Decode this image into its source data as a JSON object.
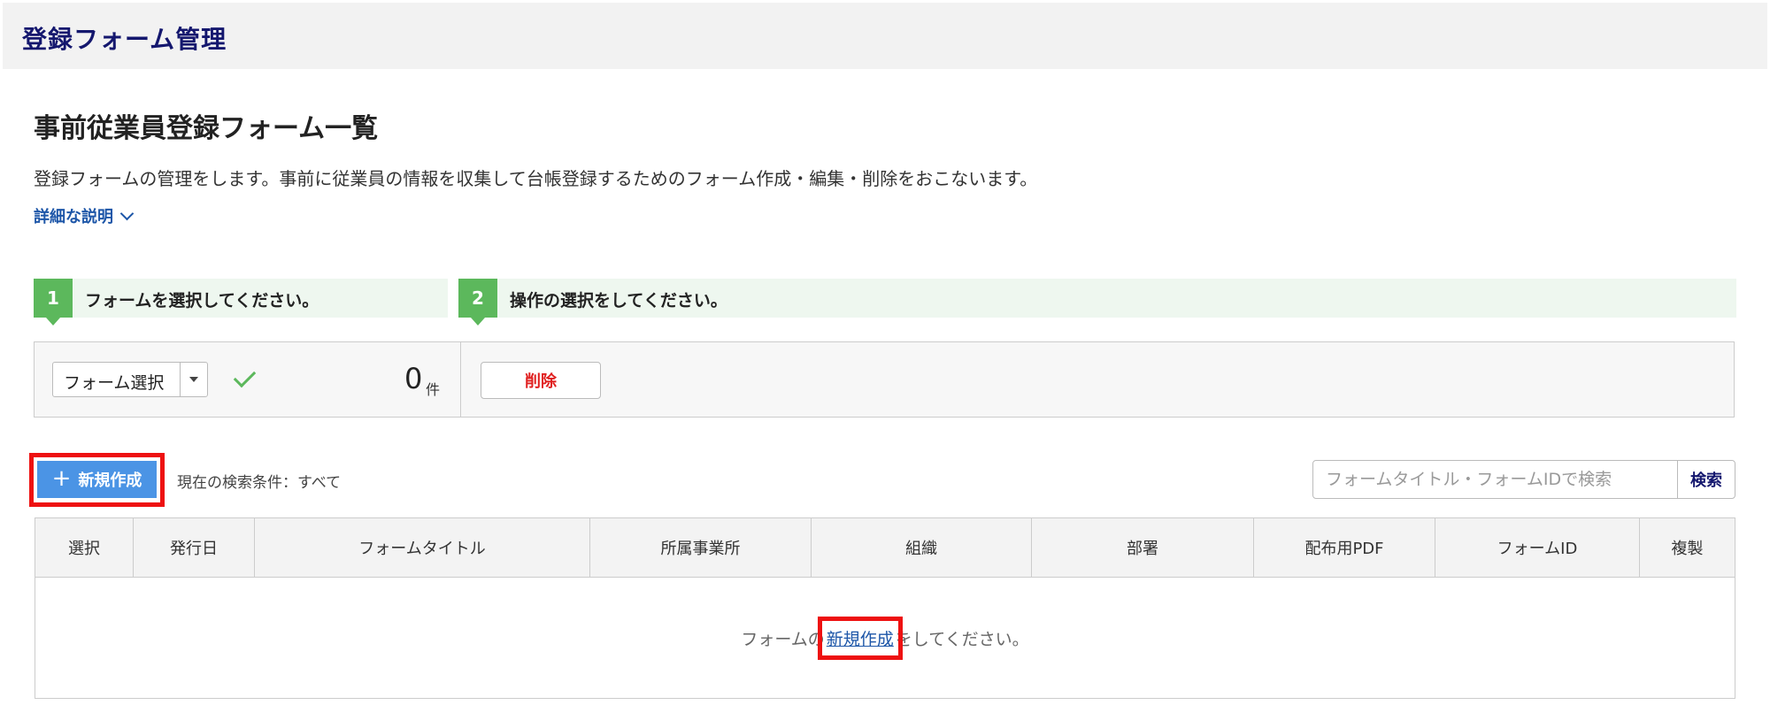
{
  "app": {
    "title": "登録フォーム管理"
  },
  "page": {
    "title": "事前従業員登録フォーム一覧",
    "description": "登録フォームの管理をします。事前に従業員の情報を収集して台帳登録するためのフォーム作成・編集・削除をおこないます。",
    "detail_link": "詳細な説明"
  },
  "steps": [
    {
      "number": "1",
      "label": "フォームを選択してください。"
    },
    {
      "number": "2",
      "label": "操作の選択をしてください。"
    }
  ],
  "operations": {
    "select_label": "フォーム選択",
    "count": "0",
    "count_unit": "件",
    "delete_label": "削除"
  },
  "toolbar": {
    "new_button": "新規作成",
    "condition_text": "現在の検索条件：すべて",
    "search_placeholder": "フォームタイトル・フォームIDで検索",
    "search_button": "検索"
  },
  "table": {
    "columns": [
      "選択",
      "発行日",
      "フォームタイトル",
      "所属事業所",
      "組織",
      "部署",
      "配布用PDF",
      "フォームID",
      "複製"
    ],
    "empty_prefix": "フォームの",
    "empty_link": "新規作成",
    "empty_suffix": "をしてください。"
  },
  "colors": {
    "accent_blue": "#4b94e5",
    "step_green": "#5cb85c",
    "highlight_red": "#ee1111",
    "title_navy": "#14176e"
  },
  "icons": [
    "chevron-down-icon",
    "dropdown-caret-icon",
    "check-icon",
    "plus-icon"
  ]
}
